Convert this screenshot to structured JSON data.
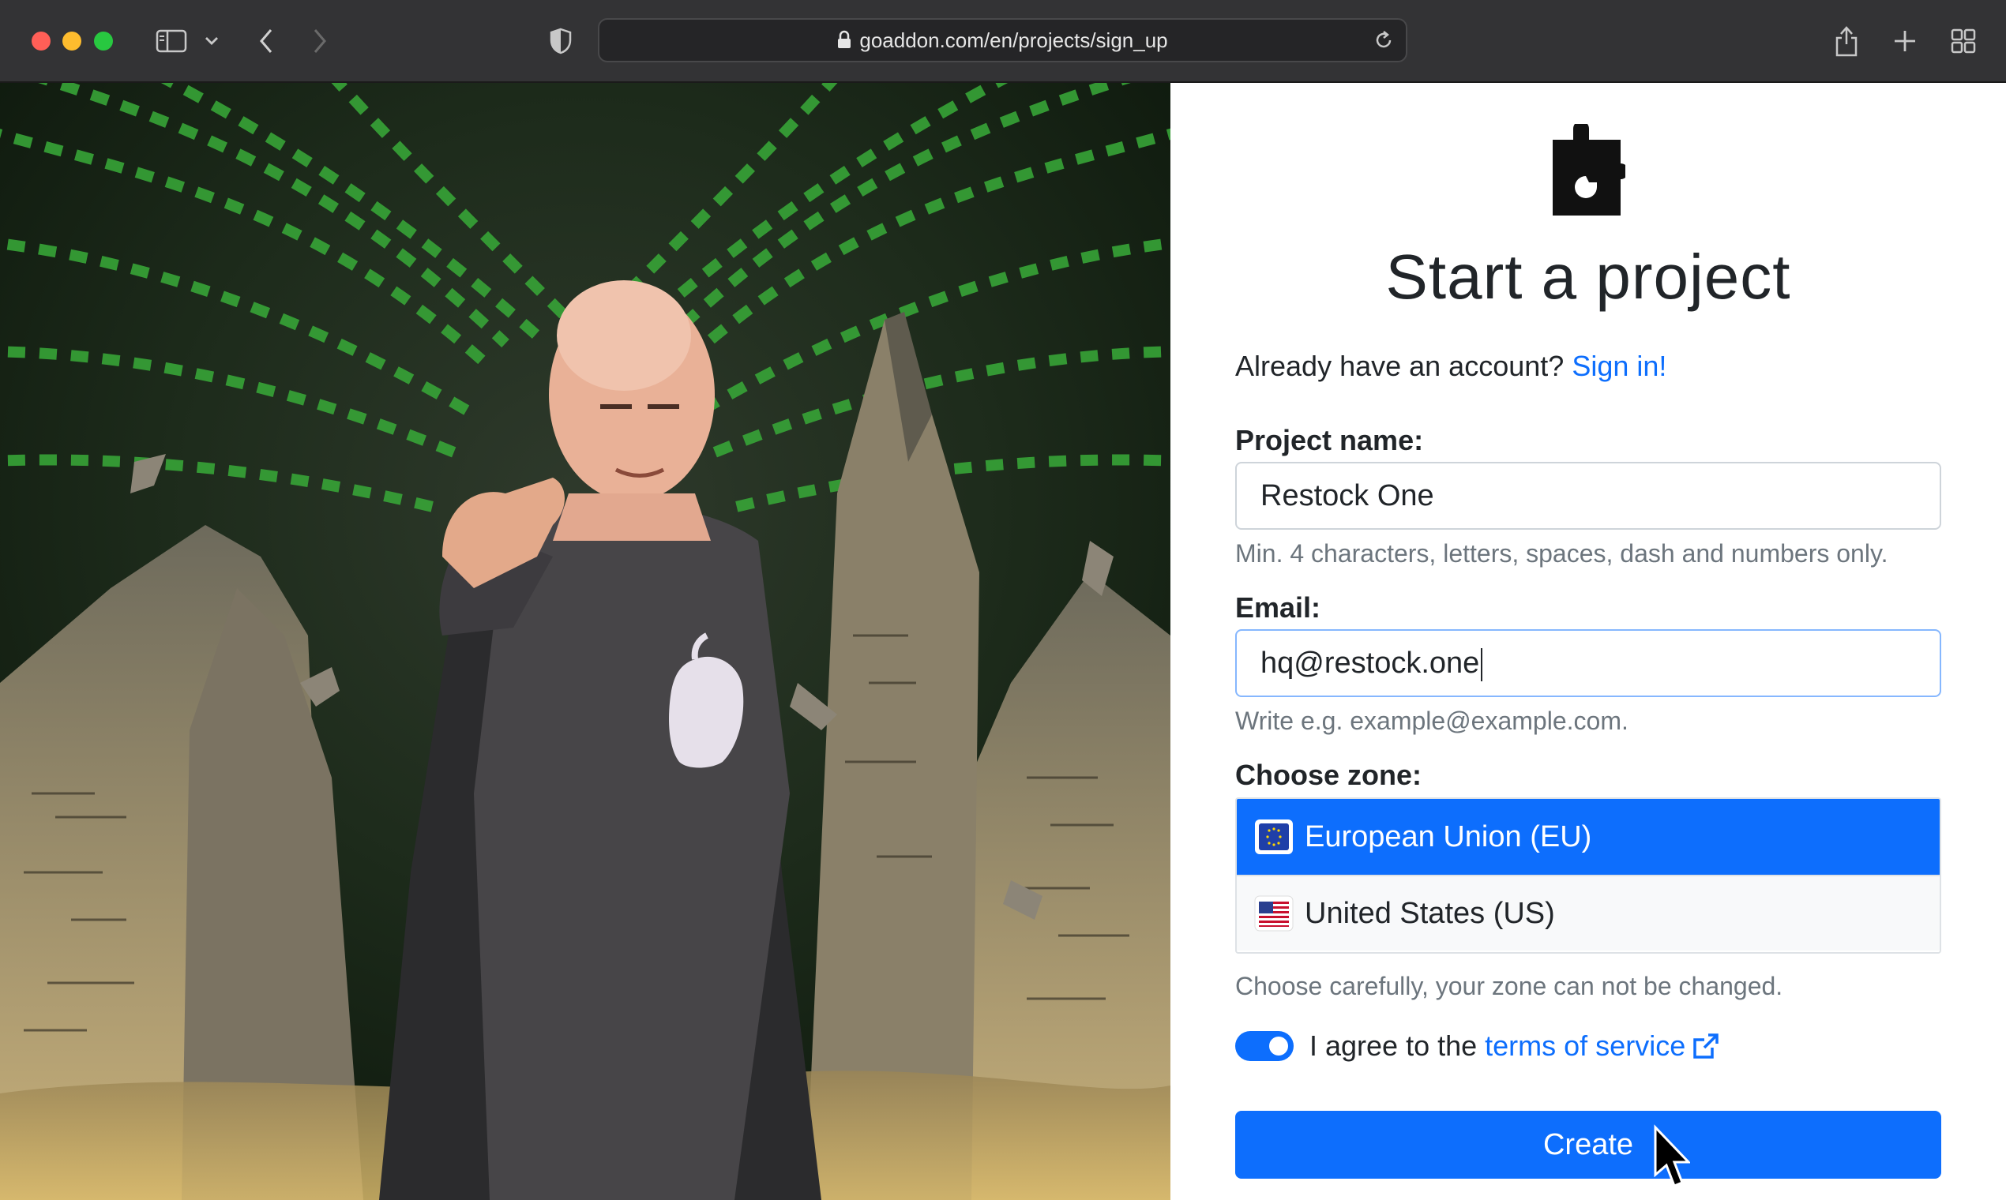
{
  "browser": {
    "url": "goaddon.com/en/projects/sign_up"
  },
  "page": {
    "title": "Start a project",
    "account_prompt": "Already have an account?",
    "signin_link": "Sign in!",
    "project_name": {
      "label": "Project name:",
      "value": "Restock One",
      "hint": "Min. 4 characters, letters, spaces, dash and numbers only."
    },
    "email": {
      "label": "Email:",
      "value": "hq@restock.one",
      "hint": "Write e.g. example@example.com."
    },
    "zone": {
      "label": "Choose zone:",
      "options": [
        {
          "label": "European Union (EU)",
          "selected": true,
          "flag": "eu-flag-icon"
        },
        {
          "label": "United States (US)",
          "selected": false,
          "flag": "us-flag-icon"
        }
      ],
      "hint": "Choose carefully, your zone can not be changed."
    },
    "terms": {
      "checked": true,
      "prefix": "I agree to the",
      "link": "terms of service"
    },
    "submit_label": "Create"
  },
  "colors": {
    "primary": "#0d6efd",
    "matrix_green": "#2e9e2e",
    "chrome": "#333335"
  }
}
